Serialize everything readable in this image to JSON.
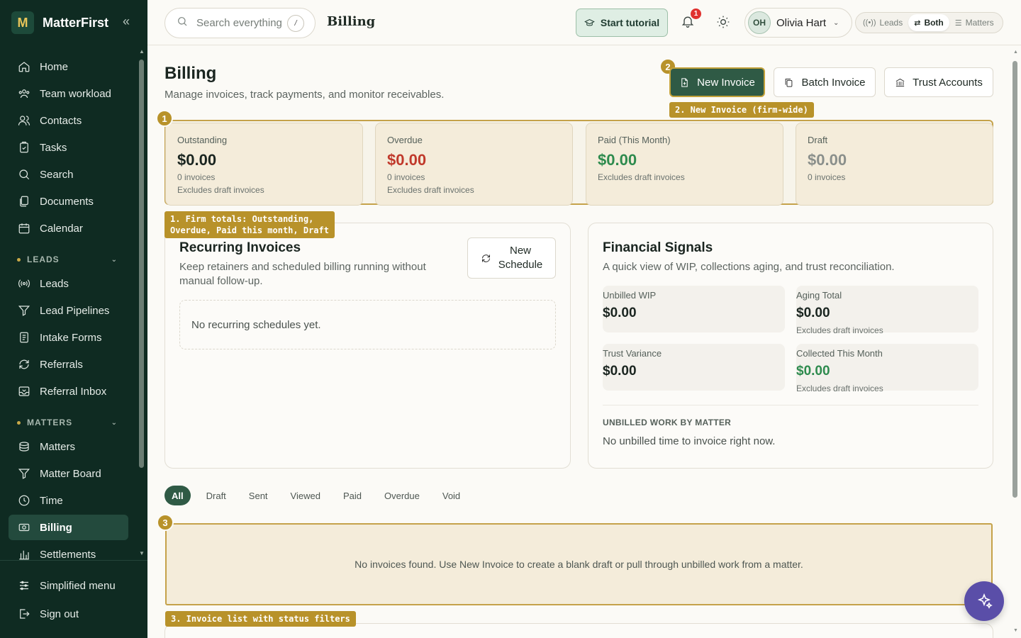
{
  "app": {
    "name": "MatterFirst",
    "logo_letter": "M"
  },
  "sidebar": {
    "items": [
      {
        "label": "Home",
        "icon": "home-icon"
      },
      {
        "label": "Team workload",
        "icon": "users-icon"
      },
      {
        "label": "Contacts",
        "icon": "contacts-icon"
      },
      {
        "label": "Tasks",
        "icon": "tasks-icon"
      },
      {
        "label": "Search",
        "icon": "search-icon"
      },
      {
        "label": "Documents",
        "icon": "documents-icon"
      },
      {
        "label": "Calendar",
        "icon": "calendar-icon"
      }
    ],
    "leads_section": {
      "label": "LEADS",
      "items": [
        {
          "label": "Leads",
          "icon": "broadcast-icon"
        },
        {
          "label": "Lead Pipelines",
          "icon": "funnel-icon"
        },
        {
          "label": "Intake Forms",
          "icon": "form-icon"
        },
        {
          "label": "Referrals",
          "icon": "refresh-icon"
        },
        {
          "label": "Referral Inbox",
          "icon": "inbox-icon"
        }
      ]
    },
    "matters_section": {
      "label": "MATTERS",
      "items": [
        {
          "label": "Matters",
          "icon": "stack-icon"
        },
        {
          "label": "Matter Board",
          "icon": "funnel-icon"
        },
        {
          "label": "Time",
          "icon": "clock-icon"
        },
        {
          "label": "Billing",
          "icon": "billing-icon"
        },
        {
          "label": "Settlements",
          "icon": "chart-icon"
        }
      ]
    },
    "bottom": [
      {
        "label": "Simplified menu",
        "icon": "sliders-icon"
      },
      {
        "label": "Sign out",
        "icon": "sign-out-icon"
      }
    ]
  },
  "topbar": {
    "search_placeholder": "Search everything",
    "search_shortcut": "/",
    "crumb": "Billing",
    "tutorial_label": "Start tutorial",
    "notification_count": "1",
    "user_initials": "OH",
    "user_name": "Olivia Hart",
    "modes": [
      "Leads",
      "Both",
      "Matters"
    ],
    "active_mode": "Both"
  },
  "page": {
    "title": "Billing",
    "subtitle": "Manage invoices, track payments, and monitor receivables.",
    "new_invoice": "New Invoice",
    "batch_invoice": "Batch Invoice",
    "trust_accounts": "Trust Accounts"
  },
  "annotations": {
    "step1": "1",
    "step2": "2",
    "step3": "3",
    "callout1_line1": "1. Firm totals: Outstanding,",
    "callout1_line2": "Overdue, Paid this month, Draft",
    "callout2": "2. New Invoice (firm-wide)",
    "callout3": "3. Invoice list with status filters"
  },
  "stats": [
    {
      "label": "Outstanding",
      "value": "$0.00",
      "color": "#1a2520",
      "line1": "0 invoices",
      "line2": "Excludes draft invoices"
    },
    {
      "label": "Overdue",
      "value": "$0.00",
      "color": "#c0392b",
      "line1": "0 invoices",
      "line2": "Excludes draft invoices"
    },
    {
      "label": "Paid (This Month)",
      "value": "$0.00",
      "color": "#2e8b4e",
      "line1": "Excludes draft invoices",
      "line2": ""
    },
    {
      "label": "Draft",
      "value": "$0.00",
      "color": "#8a8f8b",
      "line1": "0 invoices",
      "line2": ""
    }
  ],
  "recurring": {
    "title": "Recurring Invoices",
    "desc": "Keep retainers and scheduled billing running without manual follow-up.",
    "new_schedule_line1": "New",
    "new_schedule_line2": "Schedule",
    "empty": "No recurring schedules yet."
  },
  "signals": {
    "title": "Financial Signals",
    "desc": "A quick view of WIP, collections aging, and trust reconciliation.",
    "metrics": [
      {
        "label": "Unbilled WIP",
        "value": "$0.00",
        "note": "",
        "color": "#1a2520"
      },
      {
        "label": "Aging Total",
        "value": "$0.00",
        "note": "Excludes draft invoices",
        "color": "#1a2520"
      },
      {
        "label": "Trust Variance",
        "value": "$0.00",
        "note": "",
        "color": "#1a2520"
      },
      {
        "label": "Collected This Month",
        "value": "$0.00",
        "note": "Excludes draft invoices",
        "color": "#2e8b4e"
      }
    ],
    "unbilled_heading": "UNBILLED WORK BY MATTER",
    "unbilled_empty": "No unbilled time to invoice right now."
  },
  "filters": [
    "All",
    "Draft",
    "Sent",
    "Viewed",
    "Paid",
    "Overdue",
    "Void"
  ],
  "active_filter": "All",
  "invoices_empty": "No invoices found. Use New Invoice to create a blank draft or pull through unbilled work from a matter."
}
